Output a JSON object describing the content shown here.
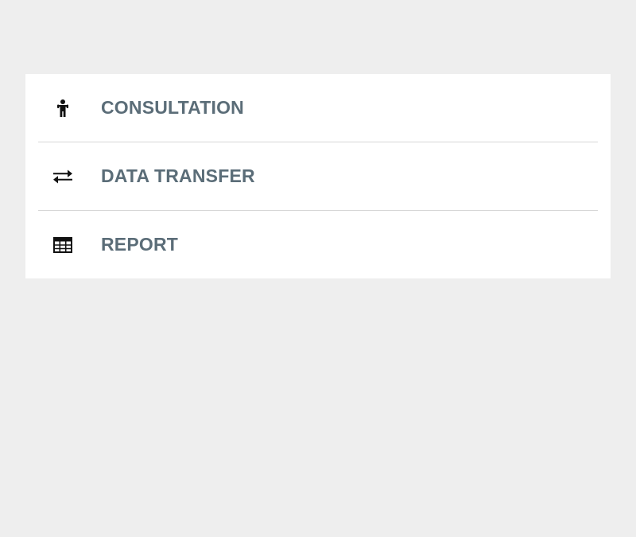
{
  "menu": {
    "items": [
      {
        "label": "CONSULTATION",
        "icon": "person-icon"
      },
      {
        "label": "DATA TRANSFER",
        "icon": "swap-arrows-icon"
      },
      {
        "label": "REPORT",
        "icon": "table-icon"
      }
    ]
  },
  "colors": {
    "background": "#eeeeee",
    "card": "#ffffff",
    "label": "#5b6d78",
    "icon": "#111111",
    "divider": "#d6d6d6"
  }
}
